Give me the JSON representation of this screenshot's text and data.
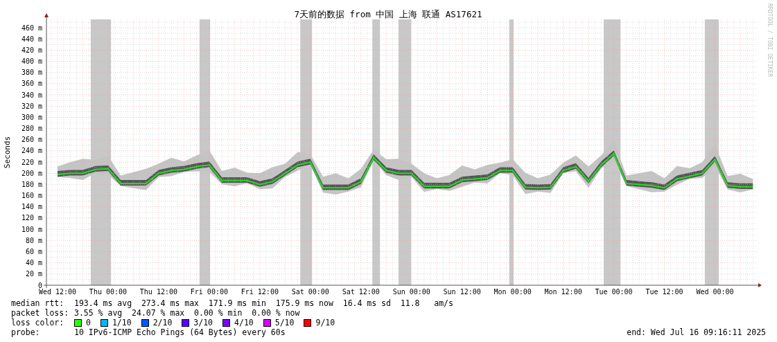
{
  "chart": {
    "watermark": "RRDTOOL / TOBI OETIKER",
    "chart_data": {
      "type": "line",
      "title": "7天前的数据 from 中国 上海 联通 AS17621",
      "ylabel": "Seconds",
      "categories": [
        "Wed 12:00",
        null,
        null,
        null,
        "Thu 00:00",
        null,
        null,
        null,
        "Thu 12:00",
        null,
        null,
        null,
        "Fri 00:00",
        null,
        null,
        null,
        "Fri 12:00",
        null,
        null,
        null,
        "Sat 00:00",
        null,
        null,
        null,
        "Sat 12:00",
        null,
        null,
        null,
        "Sun 00:00",
        null,
        null,
        null,
        "Sun 12:00",
        null,
        null,
        null,
        "Mon 00:00",
        null,
        null,
        null,
        "Mon 12:00",
        null,
        null,
        null,
        "Tue 00:00",
        null,
        null,
        null,
        "Tue 12:00",
        null,
        null,
        null,
        "Wed 00:00",
        null,
        null,
        null
      ],
      "values": [
        198,
        200,
        200,
        207,
        208,
        182,
        182,
        182,
        200,
        205,
        207,
        212,
        215,
        187,
        187,
        187,
        180,
        185,
        200,
        215,
        220,
        174,
        174,
        174,
        185,
        228,
        205,
        200,
        200,
        177,
        177,
        177,
        188,
        190,
        192,
        205,
        205,
        175,
        174,
        175,
        205,
        212,
        186,
        215,
        235,
        182,
        180,
        178,
        174,
        190,
        195,
        200,
        225,
        178,
        176,
        176
      ],
      "ylim": [
        0,
        475
      ],
      "yticks": [
        {
          "value": 0,
          "label": "0"
        },
        {
          "value": 20,
          "label": "20 m"
        },
        {
          "value": 40,
          "label": "40 m"
        },
        {
          "value": 60,
          "label": "60 m"
        },
        {
          "value": 80,
          "label": "80 m"
        },
        {
          "value": 100,
          "label": "100 m"
        },
        {
          "value": 120,
          "label": "120 m"
        },
        {
          "value": 140,
          "label": "140 m"
        },
        {
          "value": 160,
          "label": "160 m"
        },
        {
          "value": 180,
          "label": "180 m"
        },
        {
          "value": 200,
          "label": "200 m"
        },
        {
          "value": 220,
          "label": "220 m"
        },
        {
          "value": 240,
          "label": "240 m"
        },
        {
          "value": 260,
          "label": "260 m"
        },
        {
          "value": 280,
          "label": "280 m"
        },
        {
          "value": 300,
          "label": "300 m"
        },
        {
          "value": 320,
          "label": "320 m"
        },
        {
          "value": 340,
          "label": "340 m"
        },
        {
          "value": 360,
          "label": "360 m"
        },
        {
          "value": 380,
          "label": "380 m"
        },
        {
          "value": 400,
          "label": "400 m"
        },
        {
          "value": 420,
          "label": "420 m"
        },
        {
          "value": 440,
          "label": "440 m"
        },
        {
          "value": 460,
          "label": "460 m"
        }
      ],
      "grid": true
    }
  },
  "legend": {
    "stats": [
      {
        "label": "median rtt:",
        "value": "193.4 ms avg  273.4 ms max  171.9 ms min  175.9 ms now  16.4 ms sd  11.8   am/s"
      },
      {
        "label": "packet loss:",
        "value": "3.55 % avg  24.07 % max  0.00 % min  0.00 % now"
      }
    ],
    "loss_color": {
      "label": "loss color:",
      "items": [
        {
          "label": "0",
          "color": "#26ff00"
        },
        {
          "label": "1/10",
          "color": "#00b8ff"
        },
        {
          "label": "2/10",
          "color": "#0059ff"
        },
        {
          "label": "3/10",
          "color": "#5e00ff"
        },
        {
          "label": "4/10",
          "color": "#7e00ff"
        },
        {
          "label": "5/10",
          "color": "#dd00ff"
        },
        {
          "label": "9/10",
          "color": "#ff0000"
        }
      ]
    },
    "probe": {
      "label": "probe:",
      "value": "10 IPv6-ICMP Echo Pings (64 Bytes) every 60s"
    },
    "end": "end: Wed Jul 16 09:16:11 2025"
  }
}
